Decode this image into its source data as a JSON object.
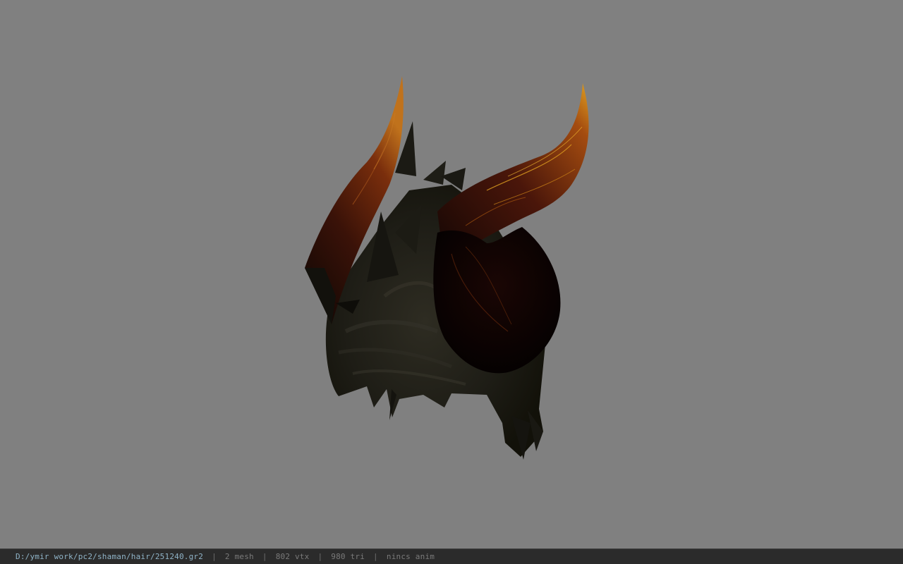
{
  "viewer": {
    "background_color": "#808080",
    "model_name": "251240.gr2"
  },
  "status_bar": {
    "file_path": "D:/ymir work/pc2/shaman/hair/251240.gr2",
    "separator": "|",
    "mesh_count": "2 mesh",
    "vertex_count": "802 vtx",
    "triangle_count": "980 tri",
    "animation": "nincs anim"
  }
}
